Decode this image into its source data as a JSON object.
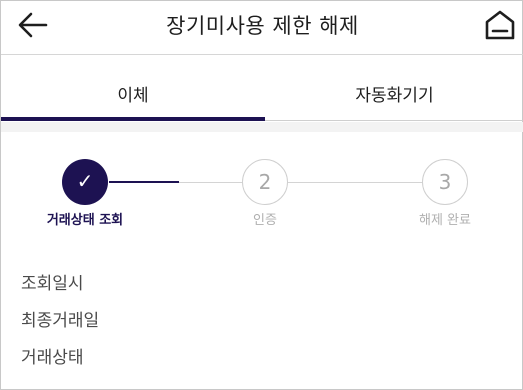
{
  "header": {
    "title": "장기미사용 제한 해제",
    "back_icon": "arrow-left-icon",
    "home_icon": "home-icon"
  },
  "tabs": [
    {
      "label": "이체",
      "active": true
    },
    {
      "label": "자동화기기",
      "active": false
    }
  ],
  "stepper": {
    "steps": [
      {
        "number": "✓",
        "label": "거래상태 조회",
        "state": "done"
      },
      {
        "number": "2",
        "label": "인증",
        "state": "pending"
      },
      {
        "number": "3",
        "label": "해제 완료",
        "state": "pending"
      }
    ]
  },
  "info": {
    "items": [
      {
        "label": "조회일시"
      },
      {
        "label": "최종거래일"
      },
      {
        "label": "거래상태"
      }
    ]
  },
  "colors": {
    "accent": "#1d1252",
    "inactive": "#b0b0b0",
    "border": "#d4d4d4"
  }
}
